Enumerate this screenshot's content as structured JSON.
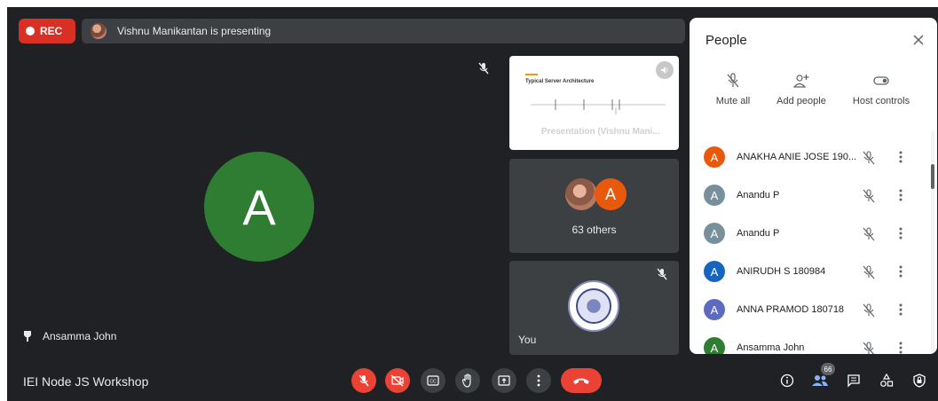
{
  "recording": {
    "label": "REC"
  },
  "presenting_banner": {
    "text": "Vishnu Manikantan is presenting"
  },
  "main_speaker": {
    "initial": "A",
    "name": "Ansamma John",
    "avatar_color": "#2e7d32"
  },
  "tiles": {
    "presentation": {
      "slide_title": "Typical Server Architecture",
      "caption": "Presentation (Vishnu Mani..."
    },
    "others": {
      "initial": "A",
      "label": "63 others",
      "avatar_color": "#e8590c"
    },
    "self": {
      "label": "You"
    }
  },
  "meeting": {
    "name": "IEI Node JS Workshop",
    "participant_count": "66"
  },
  "controls": {
    "mic": "mic-off-icon",
    "camera": "camera-off-icon",
    "captions": "closed-captions-icon",
    "hand": "raise-hand-icon",
    "present": "present-screen-icon",
    "more": "more-options-icon",
    "leave": "leave-call-icon"
  },
  "people_panel": {
    "title": "People",
    "actions": [
      "Mute all",
      "Add people",
      "Host controls"
    ],
    "participants": [
      {
        "initial": "A",
        "name": "ANAKHA ANIE JOSE 190...",
        "color": "#e8590c"
      },
      {
        "initial": "A",
        "name": "Anandu P",
        "color": "#78909c"
      },
      {
        "initial": "A",
        "name": "Anandu P",
        "color": "#78909c"
      },
      {
        "initial": "A",
        "name": "ANIRUDH S 180984",
        "color": "#1565c0"
      },
      {
        "initial": "A",
        "name": "ANNA PRAMOD 180718",
        "color": "#5c6bc0"
      },
      {
        "initial": "A",
        "name": "Ansamma John",
        "color": "#2e7d32"
      }
    ]
  },
  "colors": {
    "background": "#202124",
    "tile": "#3c4043",
    "danger": "#ea4335"
  }
}
